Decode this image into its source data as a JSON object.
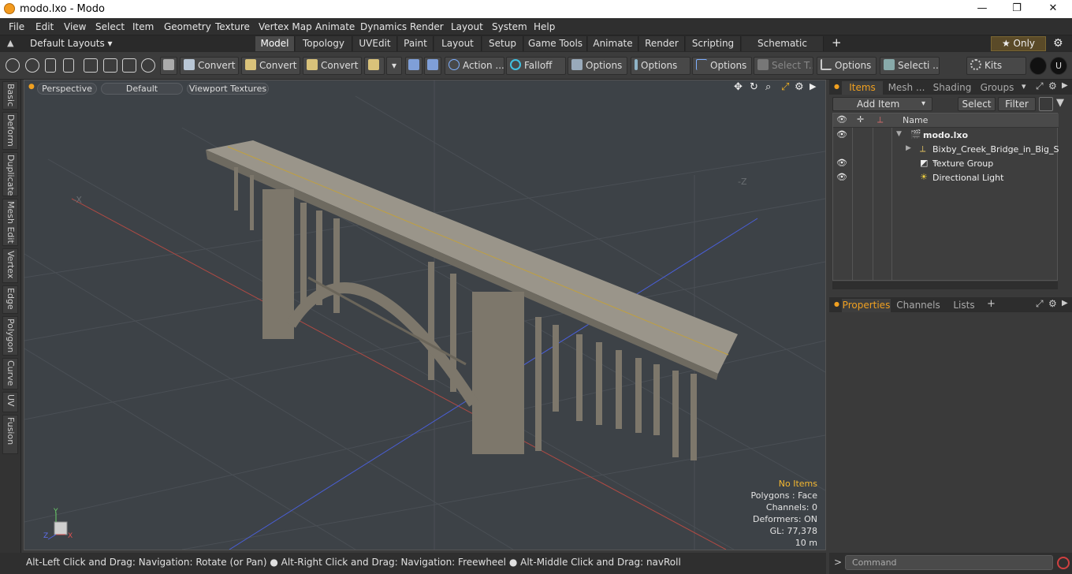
{
  "window": {
    "title": "modo.lxo - Modo",
    "minimize": "—",
    "maximize": "❐",
    "close": "✕"
  },
  "menu": [
    "File",
    "Edit",
    "View",
    "Select",
    "Item",
    "Geometry",
    "Texture",
    "Vertex Map",
    "Animate",
    "Dynamics",
    "Render",
    "Layout",
    "System",
    "Help"
  ],
  "layouts": {
    "default_label": "Default Layouts ▾",
    "tabs": [
      "Model",
      "Topology",
      "UVEdit",
      "Paint",
      "Layout",
      "Setup",
      "Game Tools",
      "Animate",
      "Render",
      "Scripting",
      "Schematic Fusion"
    ],
    "active": "Model",
    "add": "+",
    "only_label": "★  Only"
  },
  "toolbar": {
    "convert1": "Convert",
    "convert2": "Convert",
    "convert3": "Convert",
    "action": "Action  ...",
    "falloff": "Falloff",
    "options1": "Options",
    "options2": "Options",
    "options3": "Options",
    "select_t": "Select T...",
    "options4": "Options",
    "selecti": "Selecti ...",
    "kits": "Kits"
  },
  "sidebar_tabs": [
    "Basic",
    "Deform",
    "Duplicate",
    "Mesh Edit",
    "Vertex",
    "Edge",
    "Polygon",
    "Curve",
    "UV",
    "Fusion"
  ],
  "viewport": {
    "view": "Perspective",
    "shading": "Default",
    "textures": "Viewport Textures",
    "axis_labels": {
      "minus_x": "-X",
      "minus_z": "-Z",
      "y": "Y",
      "x": "X",
      "z": "Z"
    },
    "stats": {
      "no_items": "No Items",
      "polygons": "Polygons : Face",
      "channels": "Channels: 0",
      "deformers": "Deformers: ON",
      "gl": "GL: 77,378",
      "scale": "10 m"
    },
    "colors": {
      "no_items": "#f5b830"
    }
  },
  "statusbar": "Alt-Left Click and Drag: Navigation: Rotate (or Pan) ● Alt-Right Click and Drag: Navigation: Freewheel ● Alt-Middle Click and Drag: navRoll",
  "items_panel": {
    "tabs": [
      "Items",
      "Mesh ...",
      "Shading",
      "Groups"
    ],
    "active_tab": "Items",
    "add_item": "Add Item",
    "select": "Select",
    "filter": "Filter",
    "col_name": "Name",
    "rows": [
      {
        "name": "modo.lxo",
        "visible": true
      },
      {
        "name": "Bixby_Creek_Bridge_in_Big_S ...",
        "visible": false
      },
      {
        "name": "Texture Group",
        "visible": true
      },
      {
        "name": "Directional Light",
        "visible": true
      }
    ]
  },
  "properties_panel": {
    "tabs": [
      "Properties",
      "Channels",
      "Lists"
    ],
    "active_tab": "Properties",
    "add": "+"
  },
  "command": {
    "placeholder": "Command",
    "prompt": ">"
  }
}
